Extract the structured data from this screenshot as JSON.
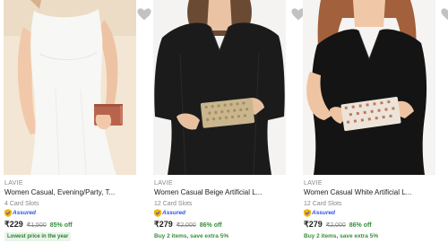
{
  "products": [
    {
      "brand": "LAVIE",
      "title": "Women Casual, Evening/Party, T...",
      "slots": "4 Card Slots",
      "assured": "Assured",
      "price": "₹229",
      "mrp": "₹1,500",
      "discount": "85% off",
      "badge": "Lowest price in the year",
      "image": "white-dress-model-brown-wallet",
      "colors": {
        "dress": "#f6f6f4",
        "wallet": "#b8644c",
        "bg": "#f3e6d4"
      }
    },
    {
      "brand": "LAVIE",
      "title": "Women Casual Beige Artificial L...",
      "slots": "12 Card Slots",
      "assured": "Assured",
      "price": "₹279",
      "mrp": "₹2,000",
      "discount": "86% off",
      "offer": "Buy 2 items, save extra 5%",
      "image": "black-dress-model-beige-wallet",
      "colors": {
        "dress": "#1a1a1a",
        "wallet": "#c9b68e",
        "bg": "#f4f3f2"
      }
    },
    {
      "brand": "LAVIE",
      "title": "Women Casual White Artificial L...",
      "slots": "12 Card Slots",
      "assured": "Assured",
      "price": "₹279",
      "mrp": "₹2,000",
      "discount": "86% off",
      "offer": "Buy 2 items, save extra 5%",
      "image": "black-dress-model-white-wallet",
      "colors": {
        "dress": "#141414",
        "wallet": "#ece4d8",
        "bg": "#f6f4f2"
      }
    }
  ],
  "icons": {
    "wishlist": "heart-icon",
    "assured": "assured-badge-icon"
  }
}
